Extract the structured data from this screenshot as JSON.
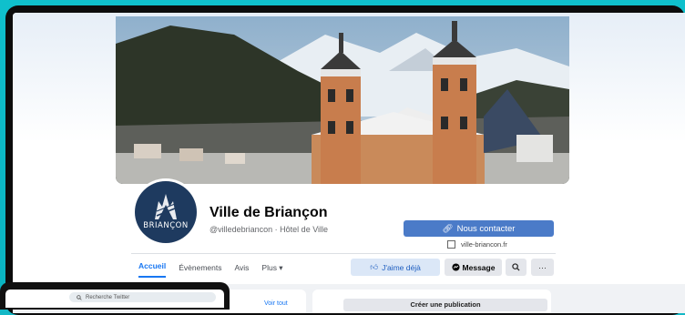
{
  "page": {
    "name": "Ville de Briançon",
    "handle_category": "@villedebriancon · Hôtel de Ville",
    "logo_text": "BRIANÇON"
  },
  "actions": {
    "contact_label": "Nous contacter",
    "website": "ville-briancon.fr",
    "like_label": "J'aime déjà",
    "message_label": "Message",
    "more_label": "···"
  },
  "tabs": [
    {
      "label": "Accueil",
      "active": true
    },
    {
      "label": "Évènements",
      "active": false
    },
    {
      "label": "Avis",
      "active": false
    },
    {
      "label": "Plus ▾",
      "active": false
    }
  ],
  "lower": {
    "voir_tout": "Voir tout",
    "right_card_title": "Créer une publication"
  },
  "twitter": {
    "search_placeholder": "Recherche Twitter"
  },
  "colors": {
    "facebook_blue": "#1877f2",
    "contact_button": "#4b7bc8",
    "logo_navy": "#1e3a5f",
    "background_teal": "#14b8c6"
  }
}
